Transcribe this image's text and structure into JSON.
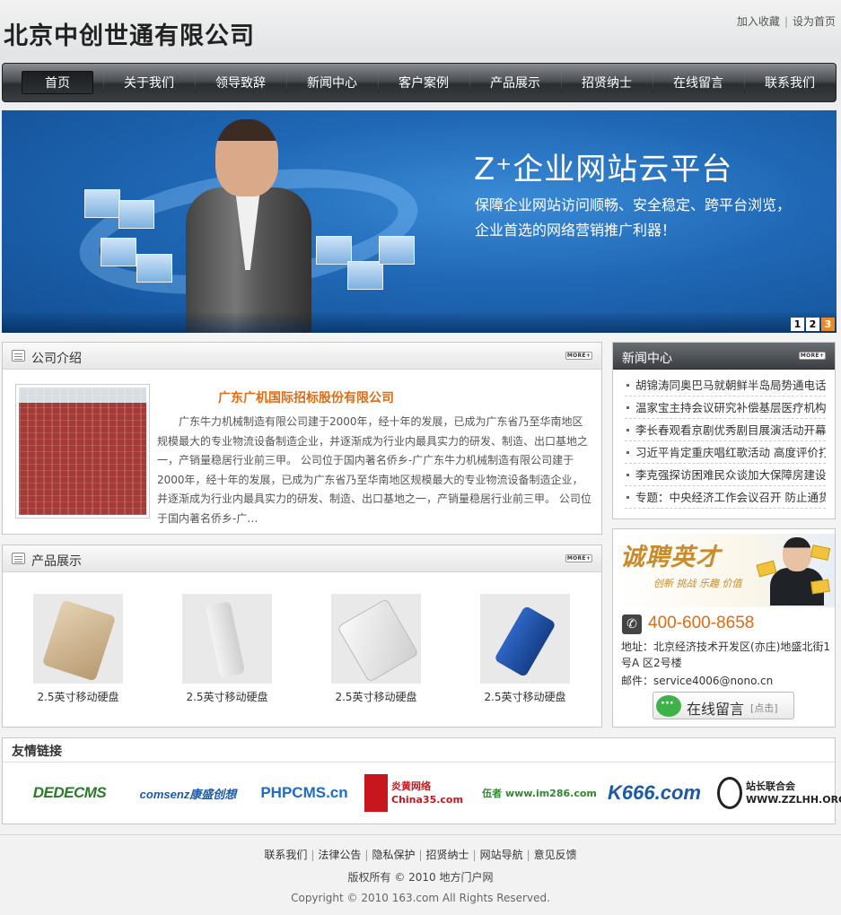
{
  "header": {
    "site_title": "北京中创世通有限公司",
    "top_links": [
      "加入收藏",
      "设为首页"
    ]
  },
  "nav": {
    "items": [
      "首页",
      "关于我们",
      "领导致辞",
      "新闻中心",
      "客户案例",
      "产品展示",
      "招贤纳士",
      "在线留言",
      "联系我们"
    ],
    "active_index": 0
  },
  "banner": {
    "title": "Z⁺企业网站云平台",
    "line1": "保障企业网站访问顺畅、安全稳定、跨平台浏览，",
    "line2": "企业首选的网络营销推广利器！",
    "pages": [
      "1",
      "2",
      "3"
    ],
    "active_page": "3"
  },
  "intro": {
    "title": "公司介绍",
    "more": "MORE+",
    "heading": "广东广机国际招标股份有限公司",
    "text": "广东牛力机械制造有限公司建于2000年，经十年的发展，已成为广东省乃至华南地区规模最大的专业物流设备制造企业，并逐渐成为行业内最具实力的研发、制造、出口基地之一，产销量稳居行业前三甲。 公司位于国内著名侨乡-广广东牛力机械制造有限公司建于2000年，经十年的发展，已成为广东省乃至华南地区规模最大的专业物流设备制造企业，并逐渐成为行业内最具实力的研发、制造、出口基地之一，产销量稳居行业前三甲。 公司位于国内著名侨乡-广…"
  },
  "products": {
    "title": "产品展示",
    "more": "MORE+",
    "items": [
      {
        "name": "2.5英寸移动硬盘"
      },
      {
        "name": "2.5英寸移动硬盘"
      },
      {
        "name": "2.5英寸移动硬盘"
      },
      {
        "name": "2.5英寸移动硬盘"
      }
    ]
  },
  "news": {
    "title": "新闻中心",
    "more": "MORE+",
    "items": [
      "胡锦涛同奥巴马就朝鲜半岛局势通电话",
      "温家宝主持会议研究补偿基层医疗机构",
      "李长春观看京剧优秀剧目展演活动开幕",
      "习近平肯定重庆唱红歌活动 高度评价打",
      "李克强探访困难民众谈加大保障房建设",
      "专题：中央经济工作会议召开 防止通货"
    ]
  },
  "contact": {
    "recruit_title": "诚聘英才",
    "recruit_words": "创新  挑战  乐趣  价值",
    "phone": "400-600-8658",
    "address_label": "地址：",
    "address": "北京经济技术开发区(亦庄)地盛北街1号A 区2号楼",
    "email_label": "邮件：",
    "email": "service4006@nono.cn",
    "message_button": "在线留言",
    "message_hint": "[点击]"
  },
  "links": {
    "title": "友情链接",
    "logos": [
      {
        "name": "DEDECMS"
      },
      {
        "name": "comsenz康盛创想"
      },
      {
        "name": "PHPCMS.cn"
      },
      {
        "name": "炎黄网络 China35.com"
      },
      {
        "name": "伍者 www.im286.com"
      },
      {
        "name": "K666.com"
      },
      {
        "name": "站长联合会 WWW.ZZLHH.ORG"
      }
    ]
  },
  "footer": {
    "links": [
      "联系我们",
      "法律公告",
      "隐私保护",
      "招贤纳士",
      "网站导航",
      "意见反馈"
    ],
    "copy1": "版权所有 © 2010 地方门户网",
    "copy2": "Copyright © 2010 163.com All Rights Reserved."
  }
}
